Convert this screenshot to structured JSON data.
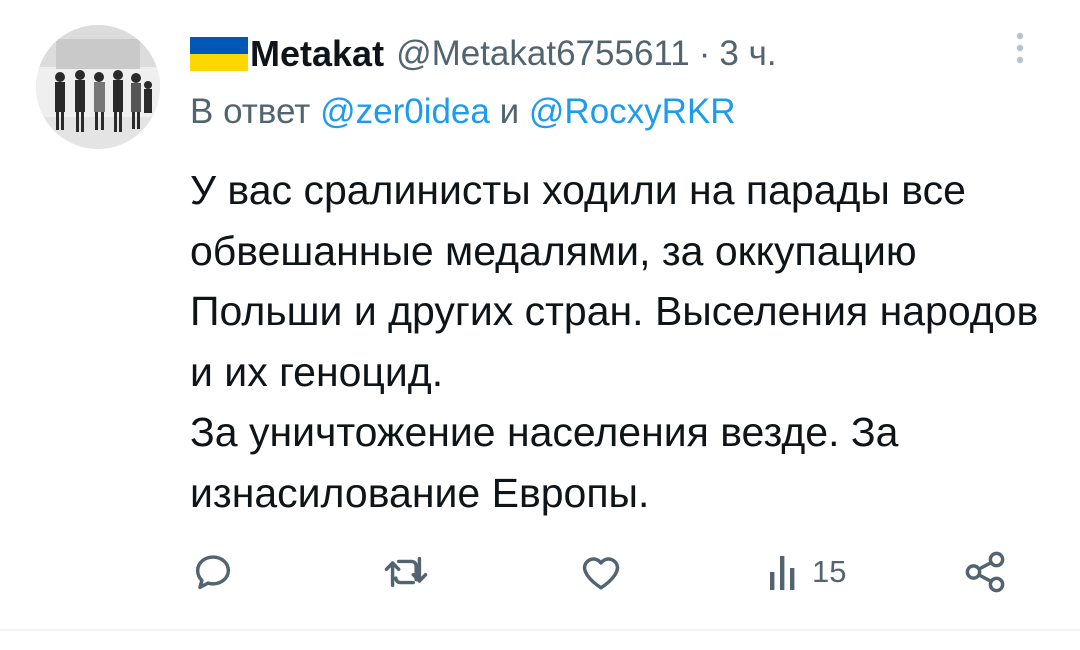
{
  "tweet": {
    "author": {
      "display_name": "Metakat",
      "handle": "@Metakat6755611",
      "flag_icon": "ukraine-flag-icon",
      "avatar": "black-and-white-group-photo-avatar"
    },
    "separator": "·",
    "time": "3 ч.",
    "reply": {
      "prefix": "В ответ",
      "mention1": "@zer0idea",
      "joiner": "и",
      "mention2": "@RocxyRKR"
    },
    "text": "У вас сралинисты ходили на парады все обвешанные медалями, за оккупацию Польши и других стран. Выселения народов и их геноцид.\nЗа уничтожение населения везде. За изнасилование Европы.",
    "actions": {
      "reply_icon": "reply-icon",
      "retweet_icon": "retweet-icon",
      "like_icon": "like-icon",
      "views_icon": "views-icon",
      "views_count": "15",
      "share_icon": "share-icon"
    }
  },
  "colors": {
    "text": "#0f1419",
    "secondary": "#536471",
    "link": "#1d9bf0",
    "flag_blue": "#0057b7",
    "flag_yellow": "#ffd700"
  }
}
